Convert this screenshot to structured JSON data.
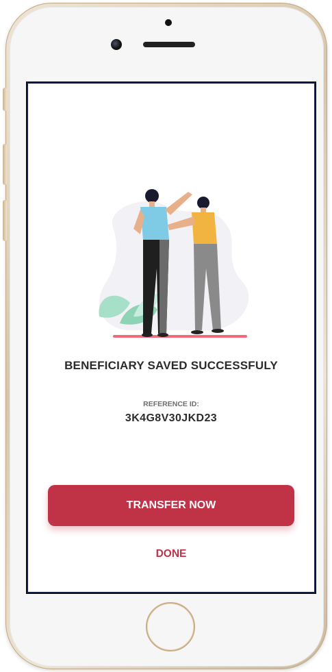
{
  "screen": {
    "title": "BENEFICIARY SAVED SUCCESSFULY",
    "reference_label": "REFERENCE ID:",
    "reference_value": "3K4G8V30JKD23",
    "primary_action": "TRANSFER NOW",
    "secondary_action": "DONE"
  },
  "colors": {
    "accent": "#c03246",
    "text_dark": "#2b2b2b",
    "text_muted": "#6d6d6d",
    "illustration_ground": "#f06a7a",
    "shirt_blue": "#7fcbe6",
    "shirt_yellow": "#f2b440",
    "leaf_green": "#8fd3b5"
  },
  "device": {
    "model": "phone-mockup"
  }
}
